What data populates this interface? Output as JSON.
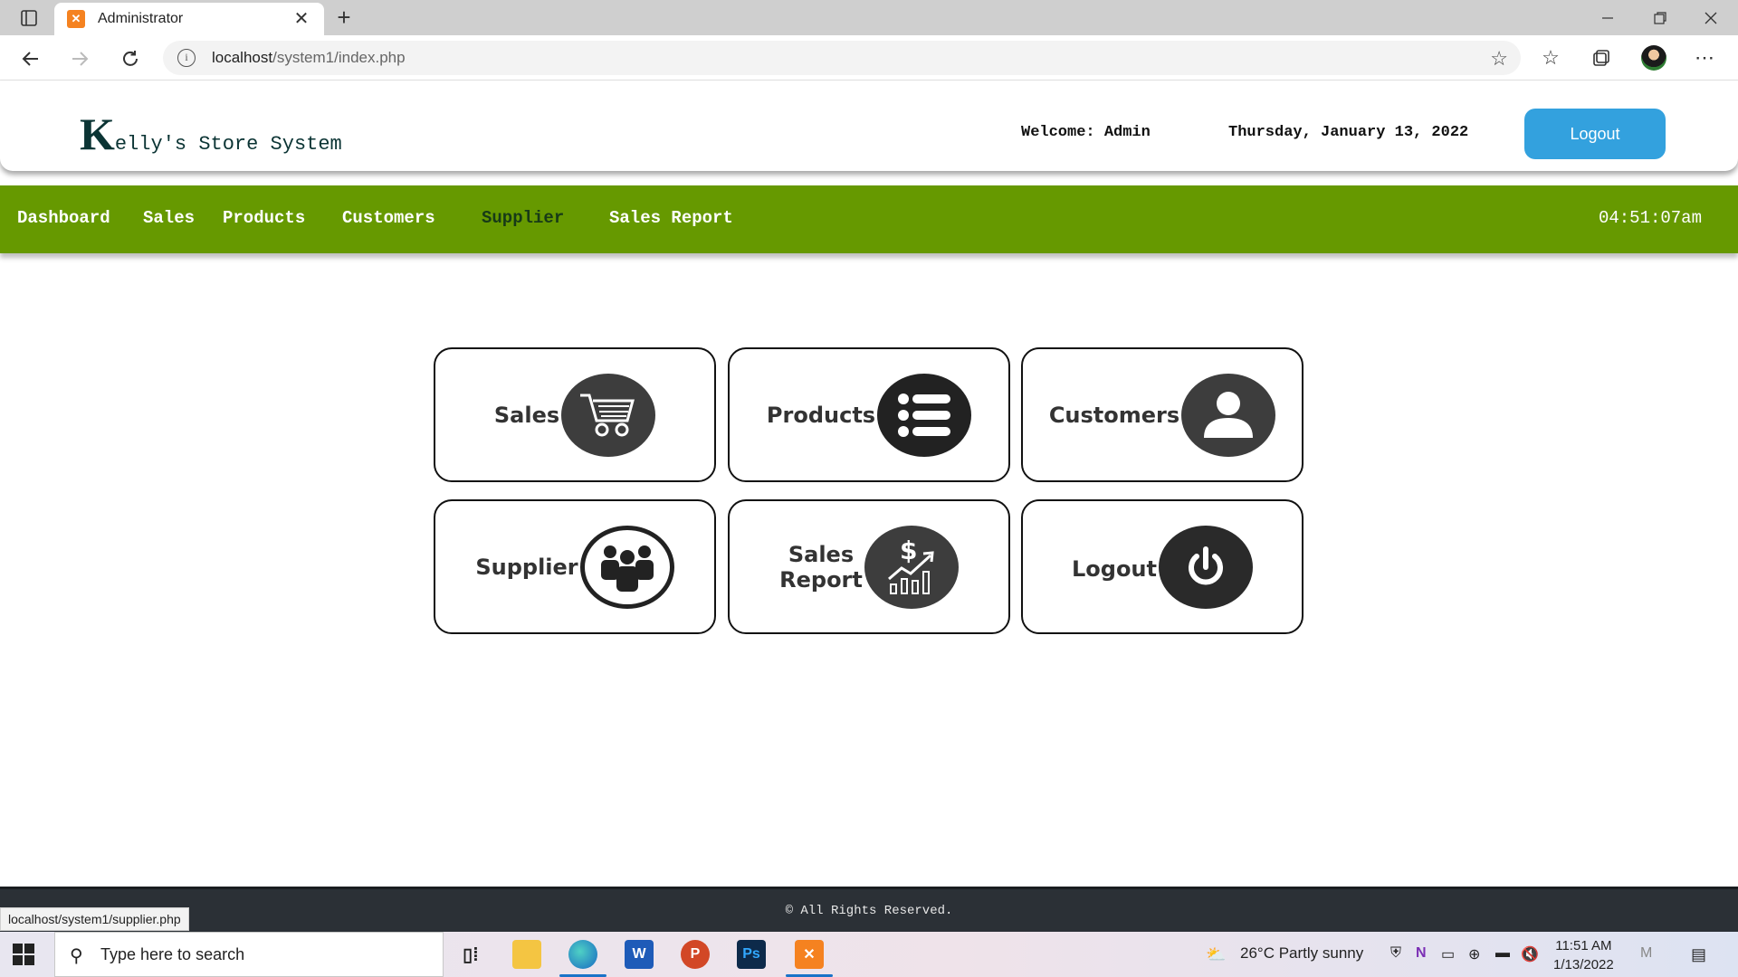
{
  "browser": {
    "tab_title": "Administrator",
    "url_host": "localhost",
    "url_path": "/system1/index.php",
    "new_tab": "+",
    "tab_close": "✕",
    "status_link": "localhost/system1/supplier.php"
  },
  "header": {
    "logo_initial": "K",
    "logo_rest": "elly's Store System",
    "welcome": "Welcome: Admin",
    "date": "Thursday, January 13, 2022",
    "logout_label": "Logout"
  },
  "menu": {
    "items": [
      "Dashboard",
      "Sales",
      "Products",
      "Customers",
      "Supplier",
      "Sales Report"
    ],
    "active": "Supplier",
    "clock": "04:51:07am"
  },
  "cards": {
    "sales": "Sales",
    "products": "Products",
    "customers": "Customers",
    "supplier": "Supplier",
    "sales_report_line1": "Sales",
    "sales_report_line2": "Report",
    "logout": "Logout"
  },
  "footer": {
    "text": "© All Rights Reserved."
  },
  "taskbar": {
    "search_placeholder": "Type here to search",
    "weather": "26°C  Partly sunny",
    "time": "11:51 AM",
    "date": "1/13/2022"
  },
  "colors": {
    "menubar": "#669900",
    "logout_button": "#33a1de",
    "footer": "#2b3036",
    "icon_circle": "#3d3d3d"
  }
}
